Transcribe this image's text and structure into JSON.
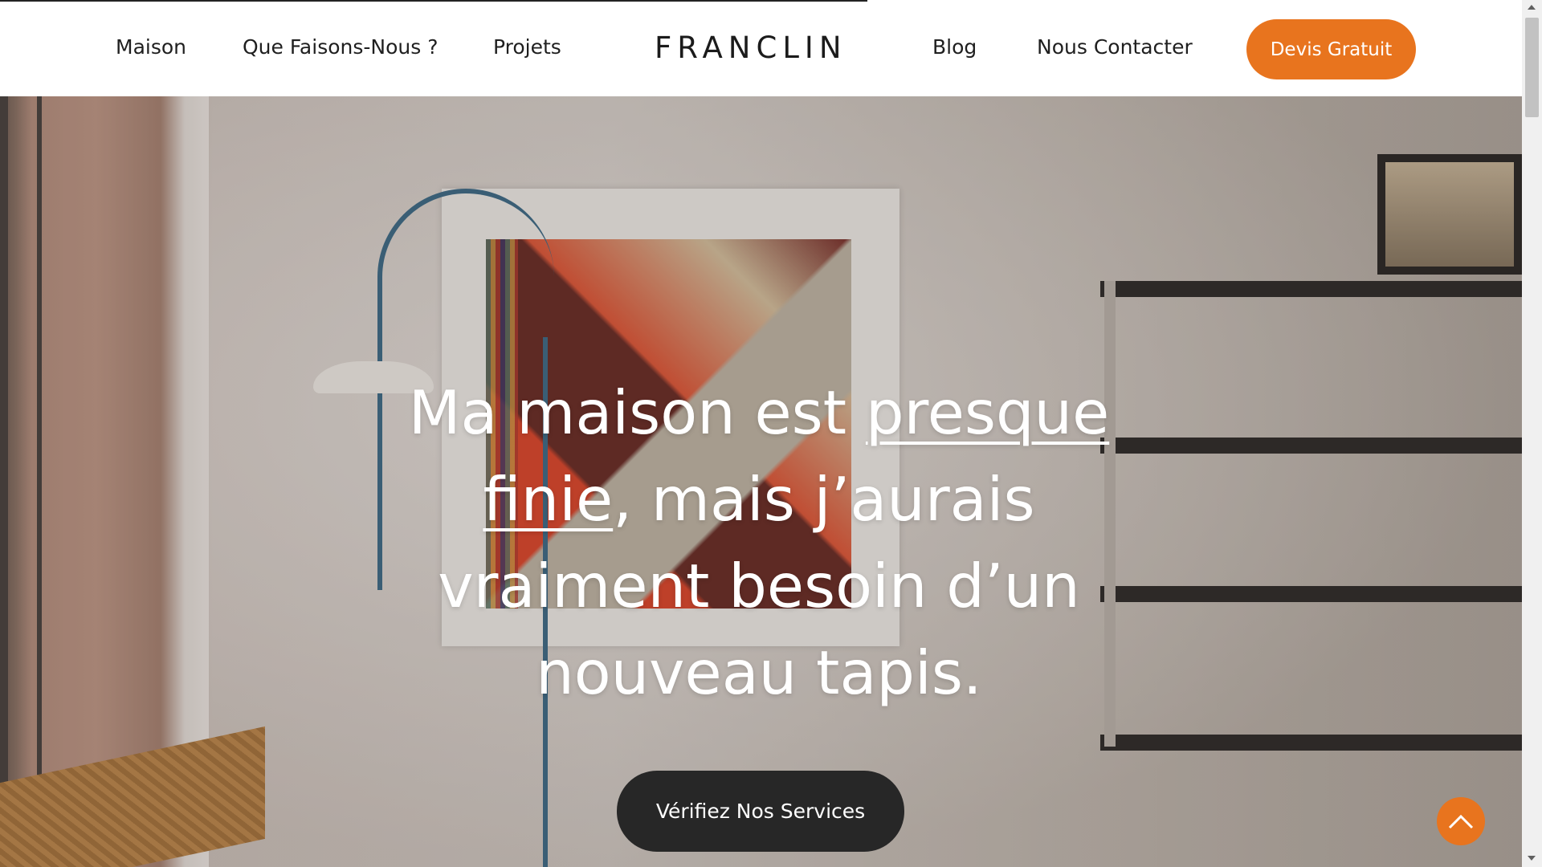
{
  "header": {
    "nav": {
      "maison": "Maison",
      "que_faisons_nous": "Que Faisons-Nous ?",
      "projets": "Projets",
      "blog": "Blog",
      "nous_contacter": "Nous Contacter"
    },
    "logo": "FRANCLIN",
    "cta_label": "Devis Gratuit"
  },
  "hero": {
    "title_part1": "Ma maison est ",
    "title_underlined": "presque finie",
    "title_part2": ", mais j’aurais vraiment besoin d’un nouveau tapis.",
    "button_label": "Vérifiez Nos Services"
  },
  "colors": {
    "accent": "#e8741e",
    "dark_button": "#272727",
    "text": "#1f1f1f"
  },
  "icons": {
    "scroll_top": "chevron-up-icon"
  }
}
